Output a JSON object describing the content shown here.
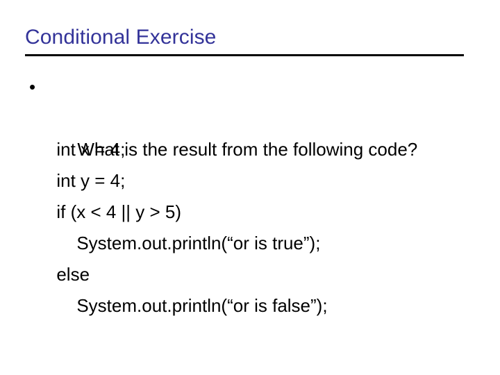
{
  "slide": {
    "title": "Conditional Exercise",
    "title_color": "#333399",
    "rule_color": "#000000",
    "background_color": "#ffffff",
    "body_color": "#000000",
    "bullet_glyph": "•",
    "lines": [
      {
        "text": "What is the result from the following code?",
        "style": "bullet"
      },
      {
        "text": "int x = 4;",
        "style": "plain"
      },
      {
        "text": "int y = 4;",
        "style": "plain"
      },
      {
        "text": "if (x < 4 || y > 5)",
        "style": "plain"
      },
      {
        "text": "System.out.println(“or is true”);",
        "style": "indent"
      },
      {
        "text": "else",
        "style": "plain"
      },
      {
        "text": "System.out.println(“or is false”);",
        "style": "indent"
      }
    ]
  }
}
